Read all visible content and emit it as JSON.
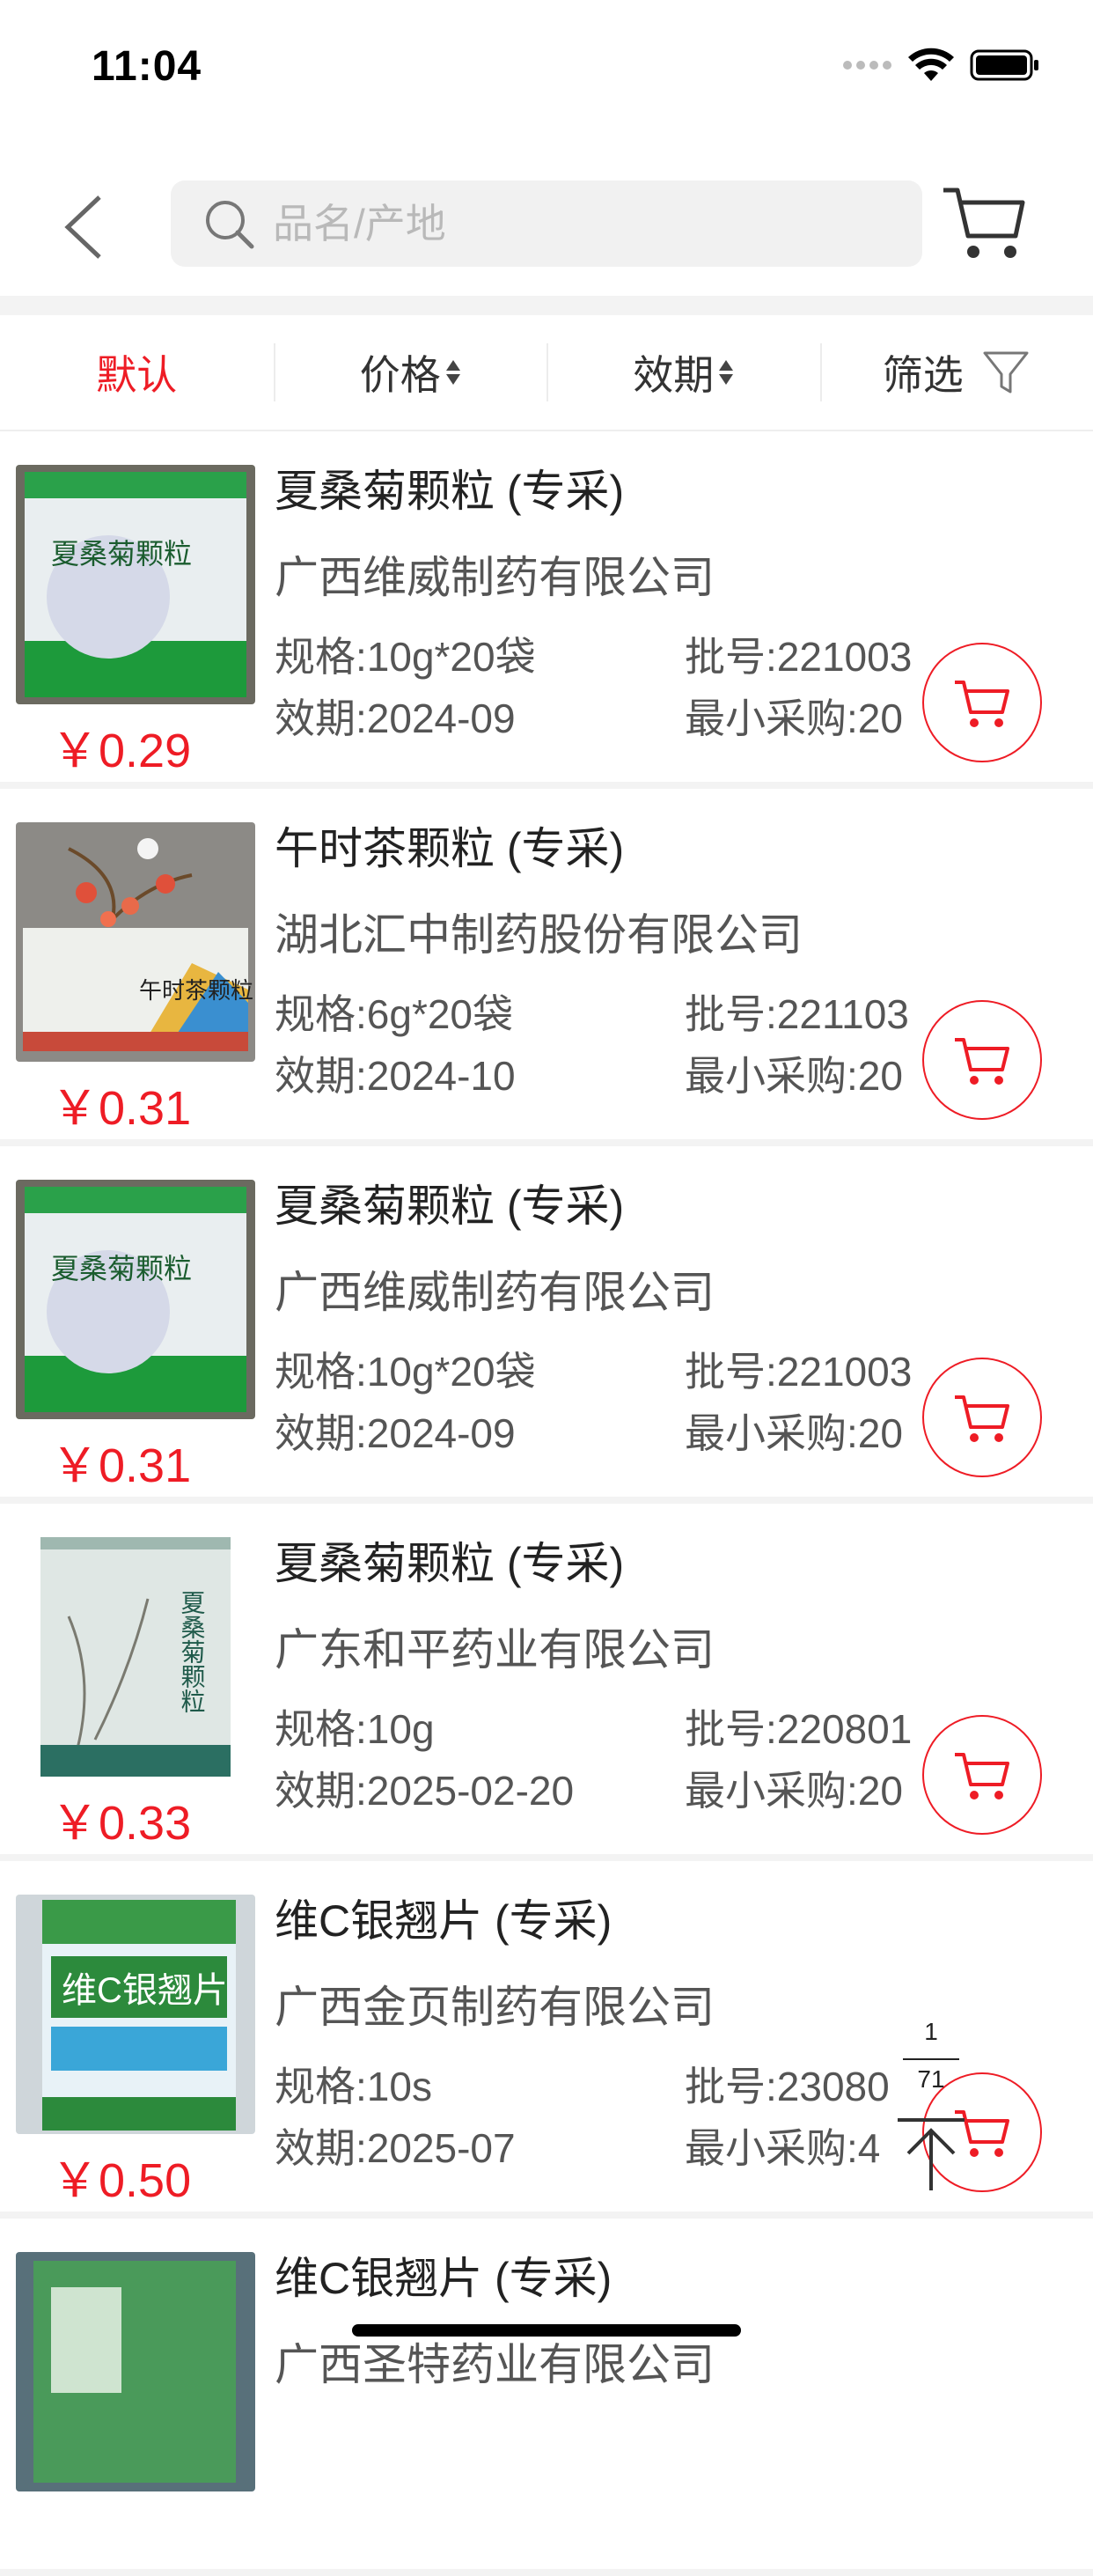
{
  "status_bar": {
    "time": "11:04"
  },
  "search": {
    "placeholder": "品名/产地",
    "value": ""
  },
  "tabs": [
    {
      "label": "默认",
      "active": true
    },
    {
      "label": "价格",
      "sortable": true
    },
    {
      "label": "效期",
      "sortable": true
    },
    {
      "label": "筛选",
      "icon": "filter-icon"
    }
  ],
  "colors": {
    "accent": "#ee1c25",
    "text": "#333333",
    "muted": "#555555",
    "divider": "#f3f3f3"
  },
  "products": [
    {
      "name": "夏桑菊颗粒 (专采)",
      "maker": "广西维威制药有限公司",
      "spec": "规格:10g*20袋",
      "batch": "批号:221003",
      "expiry": "效期:2024-09",
      "min_buy": "最小采购:20",
      "price": "￥0.29",
      "image_label": "夏桑菊颗粒",
      "image_style": "green-bag"
    },
    {
      "name": "午时茶颗粒 (专采)",
      "maker": "湖北汇中制药股份有限公司",
      "spec": "规格:6g*20袋",
      "batch": "批号:221103",
      "expiry": "效期:2024-10",
      "min_buy": "最小采购:20",
      "price": "￥0.31",
      "image_label": "午时茶颗粒",
      "image_style": "box"
    },
    {
      "name": "夏桑菊颗粒 (专采)",
      "maker": "广西维威制药有限公司",
      "spec": "规格:10g*20袋",
      "batch": "批号:221003",
      "expiry": "效期:2024-09",
      "min_buy": "最小采购:20",
      "price": "￥0.31",
      "image_label": "夏桑菊颗粒",
      "image_style": "green-bag"
    },
    {
      "name": "夏桑菊颗粒 (专采)",
      "maker": "广东和平药业有限公司",
      "spec": "规格:10g",
      "batch": "批号:220801",
      "expiry": "效期:2025-02-20",
      "min_buy": "最小采购:20",
      "price": "￥0.33",
      "image_label": "夏桑菊颗粒",
      "image_style": "white-sachet"
    },
    {
      "name": "维C银翘片 (专采)",
      "maker": "广西金页制药有限公司",
      "spec": "规格:10s",
      "batch": "批号:23080",
      "expiry": "效期:2025-07",
      "min_buy": "最小采购:4",
      "price": "￥0.50",
      "image_label": "维C银翘片",
      "image_style": "blue-bag"
    },
    {
      "name": "维C银翘片 (专采)",
      "maker": "广西圣特药业有限公司",
      "spec": "",
      "batch": "",
      "expiry": "",
      "min_buy": "",
      "price": "",
      "image_label": "",
      "image_style": "partial"
    }
  ],
  "pager": {
    "current": "1",
    "total": "71"
  }
}
